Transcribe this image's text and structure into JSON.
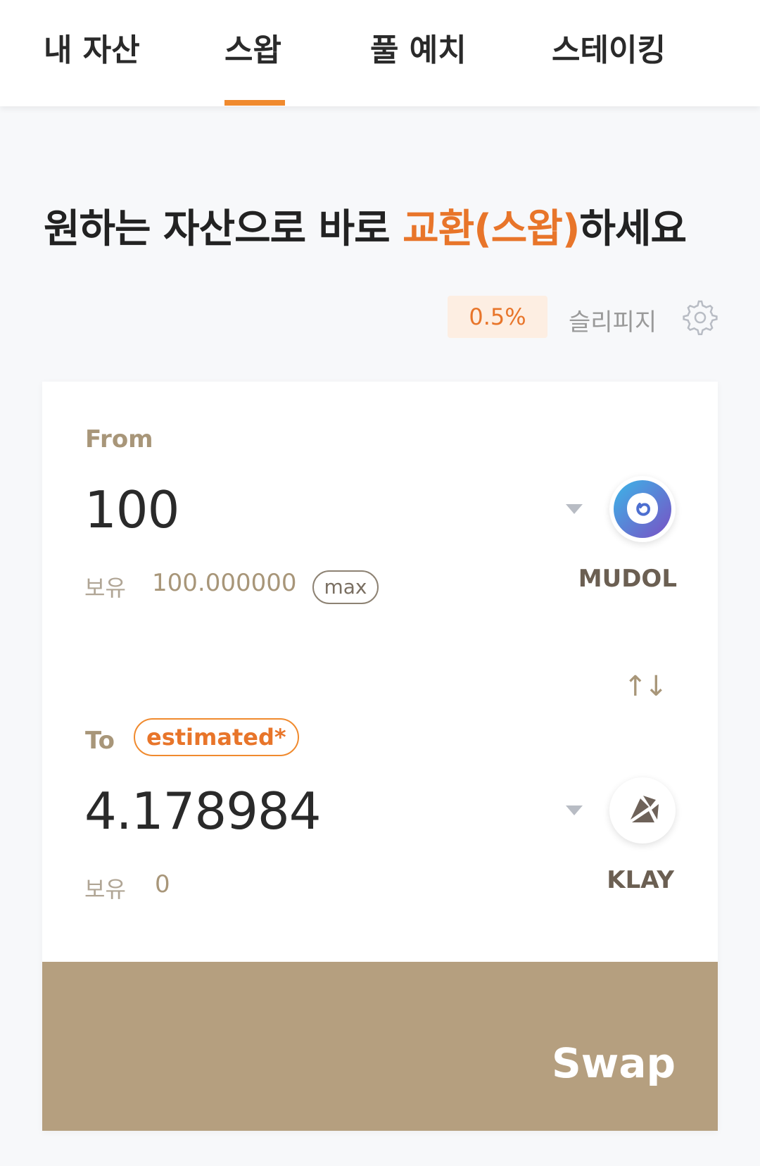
{
  "tabs": [
    {
      "label": "내 자산"
    },
    {
      "label": "스왑"
    },
    {
      "label": "풀 예치"
    },
    {
      "label": "스테이킹"
    }
  ],
  "active_tab_index": 1,
  "headline": {
    "prefix": "원하는 자산으로 바로 ",
    "highlight": "교환(스왑)",
    "suffix": "하세요"
  },
  "slippage": {
    "value": "0.5%",
    "label": "슬리피지"
  },
  "from": {
    "label": "From",
    "amount": "100",
    "balance_label": "보유",
    "balance_value": "100.000000",
    "max_label": "max",
    "token": "MUDOL"
  },
  "to": {
    "label": "To",
    "badge": "estimated*",
    "amount": "4.178984",
    "balance_label": "보유",
    "balance_value": "0",
    "token": "KLAY"
  },
  "switch_icon": "↑↓",
  "swap_button": {
    "label": "Swap"
  },
  "colors": {
    "accent": "#f08a2e",
    "swap_button": "#b59f7f",
    "muted": "#a89679"
  }
}
